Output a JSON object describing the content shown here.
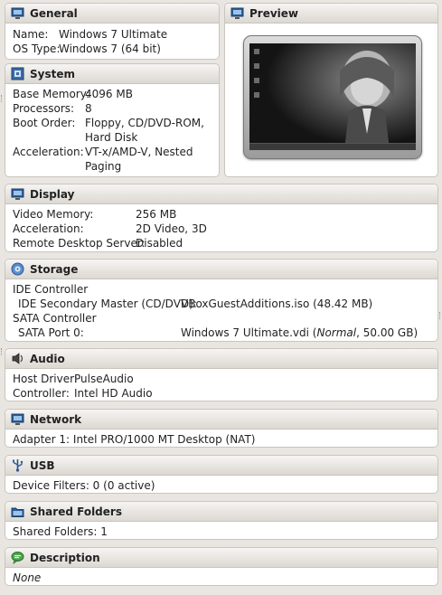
{
  "general": {
    "title": "General",
    "name_key": "Name:",
    "name_val": "Windows 7 Ultimate",
    "os_key": "OS Type:",
    "os_val": "Windows 7 (64 bit)"
  },
  "preview": {
    "title": "Preview"
  },
  "system": {
    "title": "System",
    "rows": [
      {
        "k": "Base Memory:",
        "v": "4096 MB"
      },
      {
        "k": "Processors:",
        "v": "8"
      },
      {
        "k": "Boot Order:",
        "v": "Floppy, CD/DVD-ROM, Hard Disk"
      },
      {
        "k": "Acceleration:",
        "v": "VT-x/AMD-V, Nested Paging"
      }
    ]
  },
  "display": {
    "title": "Display",
    "rows": [
      {
        "k": "Video Memory:",
        "v": "256 MB"
      },
      {
        "k": "Acceleration:",
        "v": "2D Video, 3D"
      },
      {
        "k": "Remote Desktop Server:",
        "v": "Disabled"
      }
    ]
  },
  "storage": {
    "title": "Storage",
    "ide_controller": "IDE Controller",
    "ide_port_key": "IDE Secondary Master (CD/DVD):",
    "ide_port_val": "VBoxGuestAdditions.iso (48.42 MB)",
    "sata_controller": "SATA Controller",
    "sata_port_key": "SATA Port 0:",
    "sata_disk": "Windows 7 Ultimate.vdi (",
    "sata_type": "Normal",
    "sata_size": ", 50.00 GB)"
  },
  "audio": {
    "title": "Audio",
    "rows": [
      {
        "k": "Host Driver:",
        "v": "PulseAudio"
      },
      {
        "k": "Controller:",
        "v": "Intel HD Audio"
      }
    ]
  },
  "network": {
    "title": "Network",
    "adapter": "Adapter 1: Intel PRO/1000 MT Desktop (NAT)"
  },
  "usb": {
    "title": "USB",
    "filters": "Device Filters: 0 (0 active)"
  },
  "shared": {
    "title": "Shared Folders",
    "folders": "Shared Folders: 1"
  },
  "description": {
    "title": "Description",
    "text": "None"
  },
  "icons": {
    "general": "monitor-icon",
    "preview": "monitor-icon",
    "system": "chip-icon",
    "display": "monitor-icon",
    "storage": "disk-icon",
    "audio": "speaker-icon",
    "network": "network-monitor-icon",
    "usb": "usb-icon",
    "shared": "folder-icon",
    "description": "speech-bubble-icon"
  }
}
